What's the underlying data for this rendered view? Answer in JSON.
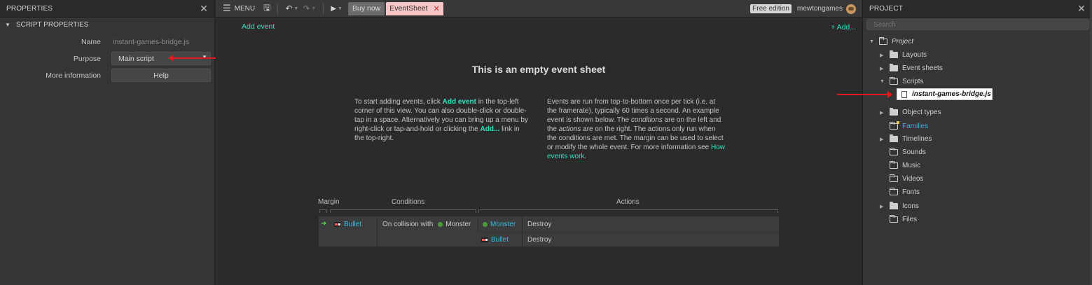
{
  "properties_panel": {
    "title": "PROPERTIES",
    "section": "SCRIPT PROPERTIES",
    "rows": [
      {
        "label": "Name",
        "value": "instant-games-bridge.js"
      },
      {
        "label": "Purpose",
        "value": "Main script"
      },
      {
        "label": "More information",
        "value": "Help"
      }
    ]
  },
  "toolbar": {
    "menu_label": "MENU",
    "tab_buy": "Buy now",
    "tab_active": "EventSheet",
    "free_edition": "Free edition",
    "username": "mewtongames"
  },
  "event_sheet": {
    "add_event": "Add event",
    "add_right": "+ Add...",
    "title": "This is an empty event sheet",
    "left_para": {
      "p1": "To start adding events, click ",
      "hl1": "Add event",
      "p2": " in the top-left corner of this view. You can also double-click or double-tap in a space. Alternatively you can bring up a menu by right-click or tap-and-hold or clicking the ",
      "hl2": "Add...",
      "p3": " link in the top-right."
    },
    "right_para": {
      "p1": "Events are run from top-to-bottom once per tick (i.e. at the framerate), typically 60 times a second. An example event is shown below. The ",
      "em1": "conditions",
      "p2": " are on the left and the ",
      "em2": "actions",
      "p3": " are on the right. The actions only run when the conditions are met. The margin can be used to select or modify the whole event. For more information see ",
      "link": "How events work",
      "p4": "."
    },
    "example": {
      "margin_label": "Margin",
      "conditions_label": "Conditions",
      "actions_label": "Actions",
      "condition_object": "Bullet",
      "condition_text": "On collision with",
      "condition_target": "Monster",
      "actions": [
        {
          "object": "Monster",
          "action": "Destroy"
        },
        {
          "object": "Bullet",
          "action": "Destroy"
        }
      ]
    }
  },
  "project_panel": {
    "title": "PROJECT",
    "search_placeholder": "Search",
    "root": "Project",
    "items": [
      {
        "label": "Layouts"
      },
      {
        "label": "Event sheets"
      },
      {
        "label": "Scripts"
      },
      {
        "label": "instant-games-bridge.js"
      },
      {
        "label": "Object types"
      },
      {
        "label": "Families"
      },
      {
        "label": "Timelines"
      },
      {
        "label": "Sounds"
      },
      {
        "label": "Music"
      },
      {
        "label": "Videos"
      },
      {
        "label": "Fonts"
      },
      {
        "label": "Icons"
      },
      {
        "label": "Files"
      }
    ]
  },
  "colors": {
    "accent": "#33e0c0",
    "object_link": "#35b9e0",
    "active_tab": "#f6c5c5",
    "annotation_arrow": "#e01a1a",
    "families_text": "#35b9e0"
  },
  "icons": {
    "close": "close-icon",
    "menu": "hamburger-icon",
    "save": "save-icon",
    "undo": "undo-icon",
    "redo": "redo-icon",
    "play": "play-icon",
    "folder": "folder-icon",
    "file": "file-icon"
  }
}
